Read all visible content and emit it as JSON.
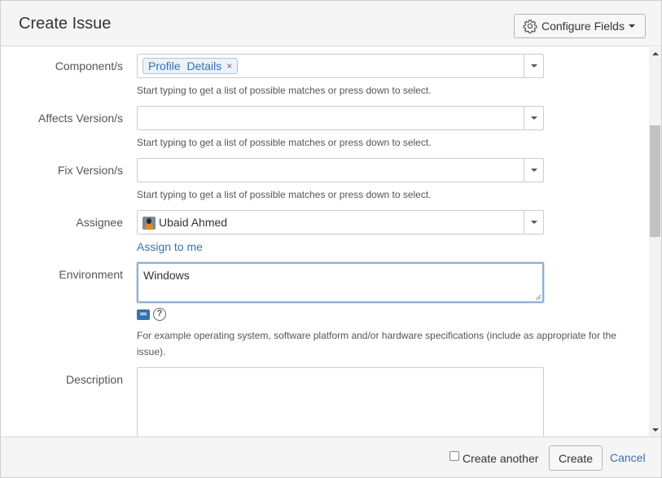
{
  "dialog": {
    "title": "Create Issue",
    "configure_fields_label": "Configure Fields"
  },
  "fields": {
    "components": {
      "label": "Component/s",
      "tags": [
        {
          "text": "Profile  Details",
          "remove": "×"
        }
      ],
      "help": "Start typing to get a list of possible matches or press down to select."
    },
    "affects_version": {
      "label": "Affects Version/s",
      "value": "",
      "help": "Start typing to get a list of possible matches or press down to select."
    },
    "fix_version": {
      "label": "Fix Version/s",
      "value": "",
      "help": "Start typing to get a list of possible matches or press down to select."
    },
    "assignee": {
      "label": "Assignee",
      "value": "Ubaid Ahmed",
      "assign_to_me": "Assign to me"
    },
    "environment": {
      "label": "Environment",
      "value": "Windows",
      "help_icon_text": "?",
      "help": "For example operating system, software platform and/or hardware specifications (include as appropriate for the issue)."
    },
    "description": {
      "label": "Description",
      "value": ""
    }
  },
  "footer": {
    "create_another_label": "Create another",
    "create_another_checked": false,
    "create_label": "Create",
    "cancel_label": "Cancel"
  },
  "colors": {
    "link": "#3572b0",
    "header_bg": "#f5f5f5",
    "tag_bg": "#ebf2f9",
    "focus_border": "#8fb1d6"
  },
  "icons": [
    "gear-icon",
    "chevron-down-icon",
    "remove-tag-icon",
    "avatar",
    "wiki-markup-icon",
    "help-icon",
    "scroll-up-icon",
    "scroll-down-icon"
  ]
}
